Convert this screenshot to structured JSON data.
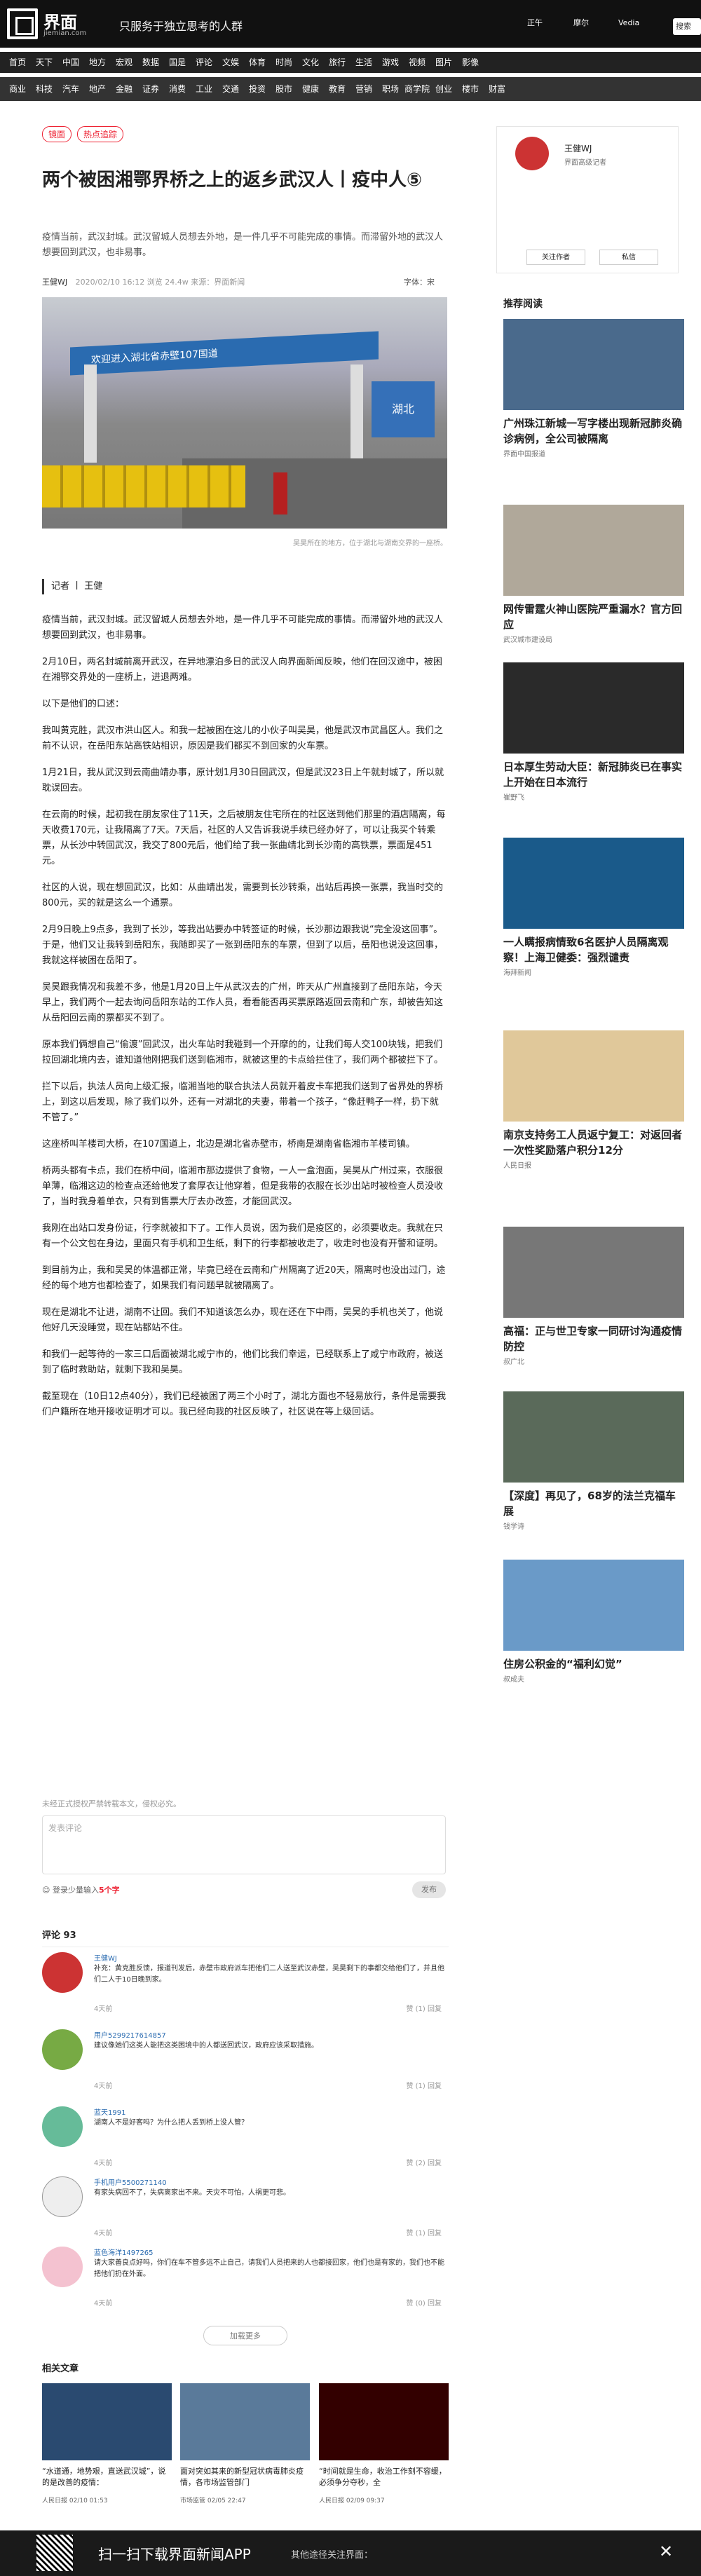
{
  "header": {
    "logo": "界面",
    "domain": "jiemian.com",
    "slogan": "只服务于独立思考的人群",
    "btns": [
      "正午",
      "摩尔",
      "Vedia"
    ],
    "search": "搜索"
  },
  "nav1": [
    "首页",
    "天下",
    "中国",
    "地方",
    "宏观",
    "数据",
    "国是",
    "评论",
    "文娱",
    "体育",
    "时尚",
    "文化",
    "旅行",
    "生活",
    "游戏",
    "视频",
    "图片",
    "影像"
  ],
  "nav2": [
    "商业",
    "科技",
    "汽车",
    "地产",
    "金融",
    "证券",
    "消费",
    "工业",
    "交通",
    "投资",
    "股市",
    "健康",
    "教育",
    "营销",
    "职场",
    "商学院",
    "创业",
    "楼市",
    "财富"
  ],
  "article": {
    "tags": [
      "镜面",
      "热点追踪"
    ],
    "title": "两个被困湘鄂界桥之上的返乡武汉人丨疫中人⑤",
    "summary": "疫情当前，武汉封城。武汉留城人员想去外地，是一件几乎不可能完成的事情。而滞留外地的武汉人想要回到武汉，也非易事。",
    "author": "王健WJ",
    "time": "2020/02/10 16:12",
    "views": "浏览 24.4w",
    "source": "来源：界面新闻",
    "font": "字体：宋",
    "caption": "吴昊所在的地方，位于湖北与湖南交界的一座桥。",
    "hero_text": "欢迎进入湖北省赤壁107国道",
    "hero_sign": "湖北",
    "reporter": "记者 丨 王健",
    "paragraphs": [
      "疫情当前，武汉封城。武汉留城人员想去外地，是一件几乎不可能完成的事情。而滞留外地的武汉人想要回到武汉，也非易事。",
      "2月10日，两名封城前离开武汉，在异地漂泊多日的武汉人向界面新闻反映，他们在回汉途中，被困在湘鄂交界处的一座桥上，进退两难。",
      "以下是他们的口述：",
      "我叫黄克胜，武汉市洪山区人。和我一起被困在这儿的小伙子叫吴昊，他是武汉市武昌区人。我们之前不认识，在岳阳东站高铁站相识，原因是我们都买不到回家的火车票。",
      "1月21日，我从武汉到云南曲靖办事，原计划1月30日回武汉，但是武汉23日上午就封城了，所以就耽误回去。",
      "在云南的时候，起初我在朋友家住了11天，之后被朋友住宅所在的社区送到他们那里的酒店隔离，每天收费170元，让我隔离了7天。7天后，社区的人又告诉我说手续已经办好了，可以让我买个转乘票，从长沙中转回武汉，我交了800元后，他们给了我一张曲靖北到长沙南的高铁票，票面是451元。",
      "社区的人说，现在想回武汉，比如：从曲靖出发，需要到长沙转乘，出站后再换一张票，我当时交的800元，买的就是这么一个通票。",
      "2月9日晚上9点多，我到了长沙，等我出站要办中转签证的时候，长沙那边跟我说“完全没这回事”。于是，他们又让我转到岳阳东，我随即买了一张到岳阳东的车票，但到了以后，岳阳也说没这回事，我就这样被困在岳阳了。",
      "吴昊跟我情况和我差不多，他是1月20日上午从武汉去的广州，昨天从广州直接到了岳阳东站，今天早上，我们两个一起去询问岳阳东站的工作人员，看看能否再买票原路返回云南和广东，却被告知这从岳阳回云南的票都买不到了。",
      "原本我们俩想自己“偷渡”回武汉，出火车站时我碰到一个开摩的的，让我们每人交100块钱，把我们拉回湖北境内去，谁知道他刚把我们送到临湘市，就被这里的卡点给拦住了，我们两个都被拦下了。",
      "拦下以后，执法人员向上级汇报，临湘当地的联合执法人员就开着皮卡车把我们送到了省界处的界桥上，到这以后发现，除了我们以外，还有一对湖北的夫妻，带着一个孩子，“像赶鸭子一样，扔下就不管了。”",
      "这座桥叫羊楼司大桥，在107国道上，北边是湖北省赤壁市，桥南是湖南省临湘市羊楼司镇。",
      "桥两头都有卡点，我们在桥中间，临湘市那边提供了食物，一人一盒泡面，吴昊从广州过来，衣服很单薄，临湘这边的检查点还给他发了套厚衣让他穿着，但是我带的衣服在长沙出站时被检查人员没收了，当时我身着单衣，只有到售票大厅去办改签，才能回武汉。",
      "我刚在出站口发身份证，行李就被扣下了。工作人员说，因为我们是疫区的，必须要收走。我就在只有一个公文包在身边，里面只有手机和卫生纸，剩下的行李都被收走了，收走时也没有开警和证明。",
      "到目前为止，我和吴昊的体温都正常，毕竟已经在云南和广州隔离了近20天，隔离时也没出过门，途经的每个地方也都检查了，如果我们有问题早就被隔离了。",
      "现在是湖北不让进，湖南不让回。我们不知道该怎么办，现在还在下中雨，吴昊的手机也关了，他说他好几天没睡觉，现在站都站不住。",
      "和我们一起等待的一家三口后面被湖北咸宁市的，他们比我们幸运，已经联系上了咸宁市政府，被送到了临时救助站，就剩下我和吴昊。",
      "截至现在（10日12点40分），我们已经被困了两三个小时了，湖北方面也不轻易放行，条件是需要我们户籍所在地开接收证明才可以。我已经向我的社区反映了，社区说在等上级回话。"
    ]
  },
  "comments_ui": {
    "note": "未经正式授权严禁转载本文，侵权必究。",
    "placeholder": "发表评论",
    "emoji": "登录少量输入",
    "emoji_count": "5个字",
    "send": "发布",
    "count": "评论 93",
    "more": "加载更多"
  },
  "comments": [
    {
      "name": "王健WJ",
      "text": "补充：黄克胜反馈，报道刊发后，赤壁市政府派车把他们二人送至武汉赤壁，吴昊剩下的事都交给他们了，并且他们二人于10日晚到家。",
      "likes": "4天前",
      "reply": "赞 (1) 回复"
    },
    {
      "name": "用户5299217614857",
      "text": "建议像她们这类人能把这类困境中的人都送回武汉，政府应该采取措施。",
      "likes": "4天前",
      "reply": "赞 (1) 回复"
    },
    {
      "name": "蓝天1991",
      "text": "湖南人不是好客吗？为什么把人丢到桥上没人管？",
      "likes": "4天前",
      "reply": "赞 (2) 回复"
    },
    {
      "name": "手机用户5500271140",
      "text": "有家失病回不了，失病离家出不来。天灾不可怕，人祸更可悲。",
      "likes": "4天前",
      "reply": "赞 (1) 回复"
    },
    {
      "name": "蓝色海洋1497265",
      "text": "请大家善良点好吗，你们在车不管多远不止自己，请我们人员把来的人也都接回家，他们也是有家的，我们也不能把他们扔在外面。",
      "likes": "4天前",
      "reply": "赞 (0) 回复"
    }
  ],
  "related": {
    "title": "相关文章",
    "items": [
      {
        "title": "“水道通，地势艰，直送武汉城”，说的是改善的疫情：",
        "date": "人民日报 02/10 01:53"
      },
      {
        "title": "面对突如其来的新型冠状病毒肺炎疫情，各市场监管部门",
        "date": "市场监管 02/05 22:47"
      },
      {
        "title": "“时间就是生命，收治工作刻不容缓，必须争分夺秒，全",
        "date": "人民日报 02/09 09:37"
      }
    ]
  },
  "bottom": {
    "title": "扫一扫下载界面新闻APP",
    "sub": "其他途径关注界面：",
    "close": "✕"
  },
  "sidebar": {
    "author": {
      "name": "王健WJ",
      "desc": "界面高级记者",
      "follow": "关注作者",
      "message": "私信"
    },
    "title": "推荐阅读",
    "items": [
      {
        "title": "广州珠江新城一写字楼出现新冠肺炎确诊病例，全公司被隔离",
        "meta": "界面中国报道"
      },
      {
        "title": "网传雷霆火神山医院严重漏水？官方回应",
        "meta": "武汉城市建设局"
      },
      {
        "title": "日本厚生劳动大臣：新冠肺炎已在事实上开始在日本流行",
        "meta": "崔野飞"
      },
      {
        "title": "一人瞒报病情致6名医护人员隔离观察！上海卫健委：强烈谴责",
        "meta": "海拜新闻"
      },
      {
        "title": "南京支持务工人员返宁复工：对返回者一次性奖励落户积分12分",
        "meta": "人民日报"
      },
      {
        "title": "高福：正与世卫专家一同研讨沟通疫情防控",
        "meta": "叔广北"
      },
      {
        "title": "【深度】再见了，68岁的法兰克福车展",
        "meta": "钱学诗"
      },
      {
        "title": "住房公积金的“福利幻觉”",
        "meta": "叔成夫"
      }
    ]
  }
}
